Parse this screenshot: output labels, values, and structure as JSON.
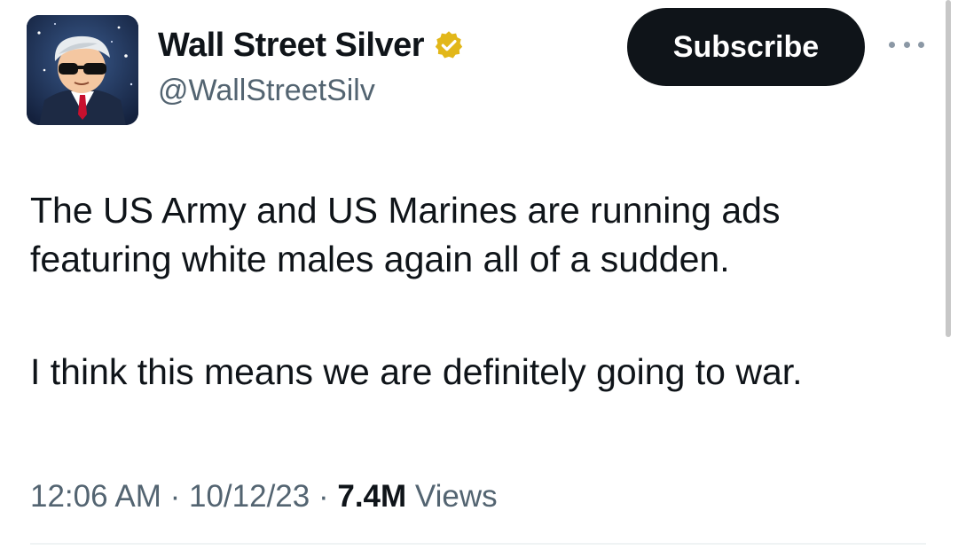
{
  "tweet": {
    "author": {
      "display_name": "Wall Street Silver",
      "handle": "@WallStreetSilv",
      "verified": true,
      "verified_color": "#e2b719",
      "avatar_icon": "avatar-icon"
    },
    "subscribe_label": "Subscribe",
    "more_icon": "more-options-icon",
    "text": {
      "line1": "The US Army and US Marines are running ads",
      "line2": "featuring white males again all of a sudden.",
      "line3": "I think this means we are definitely going to war."
    },
    "meta": {
      "time": "12:06 AM",
      "sep1": " · ",
      "date": "10/12/23",
      "sep2": " · ",
      "views_count": "7.4M",
      "views_label": " Views"
    }
  },
  "colors": {
    "text_primary": "#0f1419",
    "text_secondary": "#536471",
    "button_bg": "#0f1419"
  }
}
